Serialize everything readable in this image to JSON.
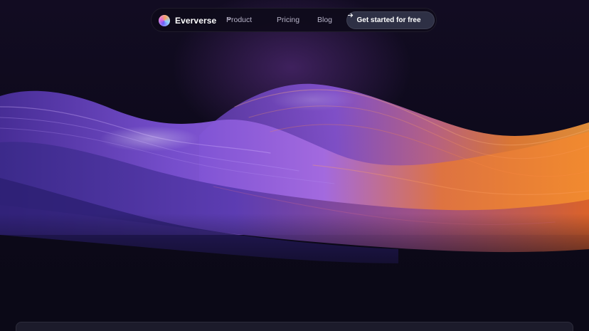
{
  "nav": {
    "brand": "Eververse",
    "items": [
      {
        "label": "Product",
        "has_dropdown": true
      },
      {
        "label": "Pricing"
      },
      {
        "label": "Blog"
      }
    ],
    "cta_label": "Get started for free"
  },
  "icons": {
    "logo": "eververse-logo-icon",
    "dropdown": "chevron-down-icon",
    "cta": "arrow-right-icon"
  },
  "colors": {
    "background": "#0b0917",
    "cta_background": "#2e3045",
    "wave_purple": "#7a4fd8",
    "wave_orange": "#f07a2a"
  }
}
